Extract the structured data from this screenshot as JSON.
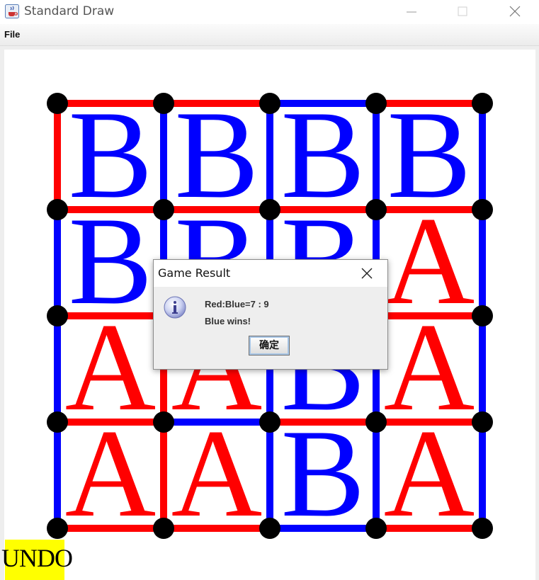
{
  "window": {
    "title": "Standard Draw",
    "icons": {
      "app": "java-coffee-icon",
      "minimize": "minimize-icon",
      "maximize": "maximize-icon",
      "close": "close-icon"
    }
  },
  "menu": {
    "file_label": "File"
  },
  "game": {
    "grid_size": 5,
    "colors": {
      "red": "#ff0000",
      "blue": "#0000ff",
      "dot": "#000000"
    },
    "horizontal_edges": [
      [
        "red",
        "red",
        "blue",
        "red"
      ],
      [
        "red",
        "red",
        "red",
        "red"
      ],
      [
        "red",
        "red",
        "red",
        "red"
      ],
      [
        "red",
        "blue",
        "red",
        "red"
      ],
      [
        "red",
        "red",
        "blue",
        "red"
      ]
    ],
    "vertical_edges": [
      [
        "red",
        "blue",
        "blue",
        "blue",
        "blue"
      ],
      [
        "blue",
        "blue",
        "blue",
        "blue",
        "blue"
      ],
      [
        "blue",
        "red",
        "blue",
        "blue",
        "blue"
      ],
      [
        "blue",
        "red",
        "blue",
        "blue",
        "blue"
      ]
    ],
    "cells": [
      [
        {
          "letter": "B",
          "color": "blue"
        },
        {
          "letter": "B",
          "color": "blue"
        },
        {
          "letter": "B",
          "color": "blue"
        },
        {
          "letter": "B",
          "color": "blue"
        }
      ],
      [
        {
          "letter": "B",
          "color": "blue"
        },
        {
          "letter": "B",
          "color": "blue"
        },
        {
          "letter": "B",
          "color": "blue"
        },
        {
          "letter": "A",
          "color": "red"
        }
      ],
      [
        {
          "letter": "A",
          "color": "red"
        },
        {
          "letter": "A",
          "color": "red"
        },
        {
          "letter": "B",
          "color": "blue"
        },
        {
          "letter": "A",
          "color": "red"
        }
      ],
      [
        {
          "letter": "A",
          "color": "red"
        },
        {
          "letter": "A",
          "color": "red"
        },
        {
          "letter": "B",
          "color": "blue"
        },
        {
          "letter": "A",
          "color": "red"
        }
      ]
    ]
  },
  "undo": {
    "label": "UNDO",
    "color": "#ffff00"
  },
  "dialog": {
    "title": "Game Result",
    "icon": "info-icon",
    "line1": "Red:Blue=7 : 9",
    "line2": "Blue wins!",
    "ok_label": "确定"
  }
}
